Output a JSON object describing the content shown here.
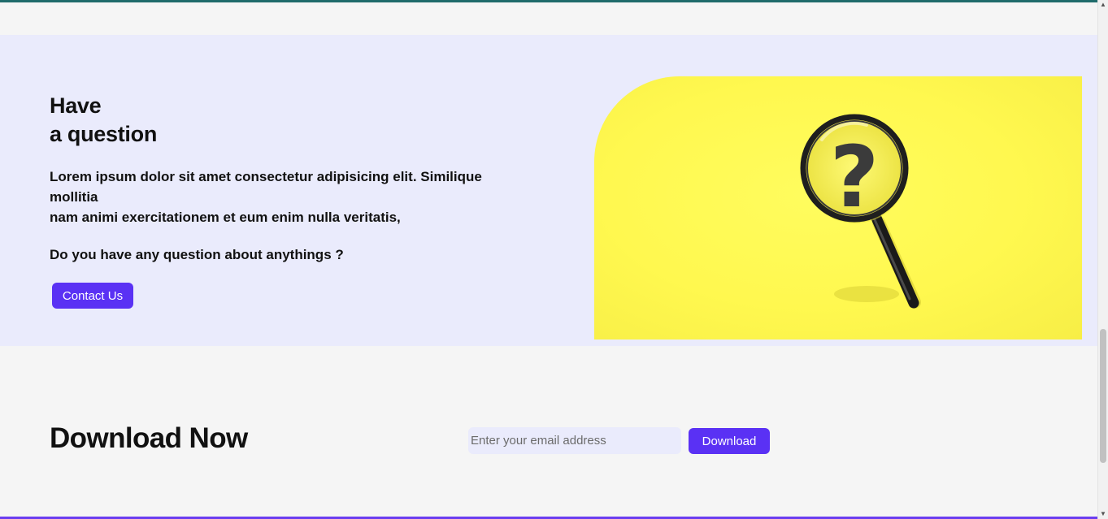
{
  "question": {
    "title_line1": "Have",
    "title_line2": "a question",
    "desc_line1": "Lorem ipsum dolor sit amet consectetur adipisicing elit. Similique mollitia",
    "desc_line2": "nam animi exercitationem et eum enim nulla veritatis,",
    "ask": "Do you have any question about anythings ?",
    "contact_label": "Contact Us",
    "image_icon": "magnifying-glass-question-icon",
    "image_bg_color": "#fff84f"
  },
  "download": {
    "title": "Download Now",
    "email_placeholder": "Enter your email address",
    "email_value": "",
    "button_label": "Download"
  },
  "colors": {
    "accent": "#5a31f4",
    "section_bg": "#eaebfc",
    "page_bg": "#f5f5f5",
    "top_border": "#1f6b6b"
  }
}
